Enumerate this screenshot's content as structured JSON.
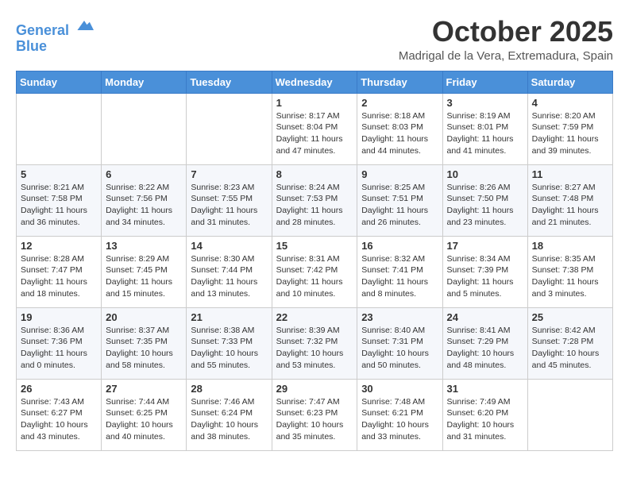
{
  "header": {
    "logo_line1": "General",
    "logo_line2": "Blue",
    "month": "October 2025",
    "location": "Madrigal de la Vera, Extremadura, Spain"
  },
  "days_of_week": [
    "Sunday",
    "Monday",
    "Tuesday",
    "Wednesday",
    "Thursday",
    "Friday",
    "Saturday"
  ],
  "weeks": [
    [
      {
        "day": "",
        "info": ""
      },
      {
        "day": "",
        "info": ""
      },
      {
        "day": "",
        "info": ""
      },
      {
        "day": "1",
        "info": "Sunrise: 8:17 AM\nSunset: 8:04 PM\nDaylight: 11 hours and 47 minutes."
      },
      {
        "day": "2",
        "info": "Sunrise: 8:18 AM\nSunset: 8:03 PM\nDaylight: 11 hours and 44 minutes."
      },
      {
        "day": "3",
        "info": "Sunrise: 8:19 AM\nSunset: 8:01 PM\nDaylight: 11 hours and 41 minutes."
      },
      {
        "day": "4",
        "info": "Sunrise: 8:20 AM\nSunset: 7:59 PM\nDaylight: 11 hours and 39 minutes."
      }
    ],
    [
      {
        "day": "5",
        "info": "Sunrise: 8:21 AM\nSunset: 7:58 PM\nDaylight: 11 hours and 36 minutes."
      },
      {
        "day": "6",
        "info": "Sunrise: 8:22 AM\nSunset: 7:56 PM\nDaylight: 11 hours and 34 minutes."
      },
      {
        "day": "7",
        "info": "Sunrise: 8:23 AM\nSunset: 7:55 PM\nDaylight: 11 hours and 31 minutes."
      },
      {
        "day": "8",
        "info": "Sunrise: 8:24 AM\nSunset: 7:53 PM\nDaylight: 11 hours and 28 minutes."
      },
      {
        "day": "9",
        "info": "Sunrise: 8:25 AM\nSunset: 7:51 PM\nDaylight: 11 hours and 26 minutes."
      },
      {
        "day": "10",
        "info": "Sunrise: 8:26 AM\nSunset: 7:50 PM\nDaylight: 11 hours and 23 minutes."
      },
      {
        "day": "11",
        "info": "Sunrise: 8:27 AM\nSunset: 7:48 PM\nDaylight: 11 hours and 21 minutes."
      }
    ],
    [
      {
        "day": "12",
        "info": "Sunrise: 8:28 AM\nSunset: 7:47 PM\nDaylight: 11 hours and 18 minutes."
      },
      {
        "day": "13",
        "info": "Sunrise: 8:29 AM\nSunset: 7:45 PM\nDaylight: 11 hours and 15 minutes."
      },
      {
        "day": "14",
        "info": "Sunrise: 8:30 AM\nSunset: 7:44 PM\nDaylight: 11 hours and 13 minutes."
      },
      {
        "day": "15",
        "info": "Sunrise: 8:31 AM\nSunset: 7:42 PM\nDaylight: 11 hours and 10 minutes."
      },
      {
        "day": "16",
        "info": "Sunrise: 8:32 AM\nSunset: 7:41 PM\nDaylight: 11 hours and 8 minutes."
      },
      {
        "day": "17",
        "info": "Sunrise: 8:34 AM\nSunset: 7:39 PM\nDaylight: 11 hours and 5 minutes."
      },
      {
        "day": "18",
        "info": "Sunrise: 8:35 AM\nSunset: 7:38 PM\nDaylight: 11 hours and 3 minutes."
      }
    ],
    [
      {
        "day": "19",
        "info": "Sunrise: 8:36 AM\nSunset: 7:36 PM\nDaylight: 11 hours and 0 minutes."
      },
      {
        "day": "20",
        "info": "Sunrise: 8:37 AM\nSunset: 7:35 PM\nDaylight: 10 hours and 58 minutes."
      },
      {
        "day": "21",
        "info": "Sunrise: 8:38 AM\nSunset: 7:33 PM\nDaylight: 10 hours and 55 minutes."
      },
      {
        "day": "22",
        "info": "Sunrise: 8:39 AM\nSunset: 7:32 PM\nDaylight: 10 hours and 53 minutes."
      },
      {
        "day": "23",
        "info": "Sunrise: 8:40 AM\nSunset: 7:31 PM\nDaylight: 10 hours and 50 minutes."
      },
      {
        "day": "24",
        "info": "Sunrise: 8:41 AM\nSunset: 7:29 PM\nDaylight: 10 hours and 48 minutes."
      },
      {
        "day": "25",
        "info": "Sunrise: 8:42 AM\nSunset: 7:28 PM\nDaylight: 10 hours and 45 minutes."
      }
    ],
    [
      {
        "day": "26",
        "info": "Sunrise: 7:43 AM\nSunset: 6:27 PM\nDaylight: 10 hours and 43 minutes."
      },
      {
        "day": "27",
        "info": "Sunrise: 7:44 AM\nSunset: 6:25 PM\nDaylight: 10 hours and 40 minutes."
      },
      {
        "day": "28",
        "info": "Sunrise: 7:46 AM\nSunset: 6:24 PM\nDaylight: 10 hours and 38 minutes."
      },
      {
        "day": "29",
        "info": "Sunrise: 7:47 AM\nSunset: 6:23 PM\nDaylight: 10 hours and 35 minutes."
      },
      {
        "day": "30",
        "info": "Sunrise: 7:48 AM\nSunset: 6:21 PM\nDaylight: 10 hours and 33 minutes."
      },
      {
        "day": "31",
        "info": "Sunrise: 7:49 AM\nSunset: 6:20 PM\nDaylight: 10 hours and 31 minutes."
      },
      {
        "day": "",
        "info": ""
      }
    ]
  ]
}
